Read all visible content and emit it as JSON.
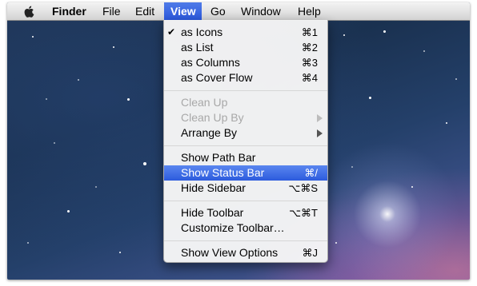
{
  "menubar": {
    "apple_icon": "apple-icon",
    "items": [
      {
        "label": "Finder"
      },
      {
        "label": "File"
      },
      {
        "label": "Edit"
      },
      {
        "label": "View"
      },
      {
        "label": "Go"
      },
      {
        "label": "Window"
      },
      {
        "label": "Help"
      }
    ]
  },
  "view_menu": {
    "items": [
      {
        "label": "as Icons",
        "shortcut": "⌘1",
        "check": "✔"
      },
      {
        "label": "as List",
        "shortcut": "⌘2"
      },
      {
        "label": "as Columns",
        "shortcut": "⌘3"
      },
      {
        "label": "as Cover Flow",
        "shortcut": "⌘4"
      },
      {
        "label": "Clean Up"
      },
      {
        "label": "Clean Up By"
      },
      {
        "label": "Arrange By"
      },
      {
        "label": "Show Path Bar"
      },
      {
        "label": "Show Status Bar",
        "shortcut": "⌘/"
      },
      {
        "label": "Hide Sidebar",
        "shortcut": "⌥⌘S"
      },
      {
        "label": "Hide Toolbar",
        "shortcut": "⌥⌘T"
      },
      {
        "label": "Customize Toolbar…"
      },
      {
        "label": "Show View Options",
        "shortcut": "⌘J"
      }
    ]
  },
  "colors": {
    "highlight": "#2c5bdd",
    "disabled_text": "#a8a8a8"
  }
}
